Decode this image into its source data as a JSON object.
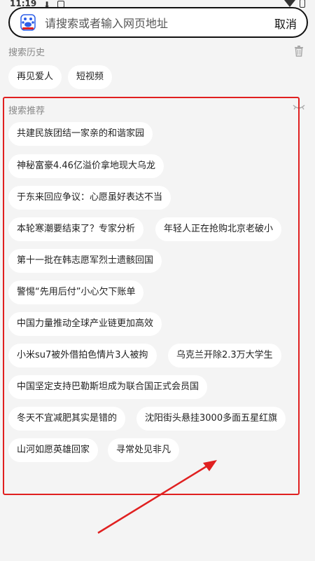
{
  "status": {
    "time": "11:19"
  },
  "search": {
    "placeholder": "请搜索或者输入网页地址",
    "cancel_label": "取消"
  },
  "history": {
    "title": "搜索历史",
    "items": [
      "再见爱人",
      "短视频"
    ]
  },
  "recommend": {
    "title": "搜索推荐",
    "items": [
      "共建民族团结一家亲的和谐家园",
      "神秘富豪4.46亿溢价拿地现大乌龙",
      "于东来回应争议：心愿虽好表达不当",
      "本轮寒潮要结束了？专家分析",
      "年轻人正在抢购北京老破小",
      "第十一批在韩志愿军烈士遗骸回国",
      "警惕“先用后付”小心欠下账单",
      "中国力量推动全球产业链更加高效",
      "小米su7被外借拍色情片3人被拘",
      "乌克兰开除2.3万大学生",
      "中国坚定支持巴勒斯坦成为联合国正式会员国",
      "冬天不宜减肥其实是错的",
      "沈阳街头悬挂3000多面五星红旗",
      "山河如愿英雄回家",
      "寻常处见非凡"
    ]
  },
  "colors": {
    "highlight": "#e02020",
    "chip_bg": "#ffffff",
    "page_bg": "#f4f4f4"
  }
}
